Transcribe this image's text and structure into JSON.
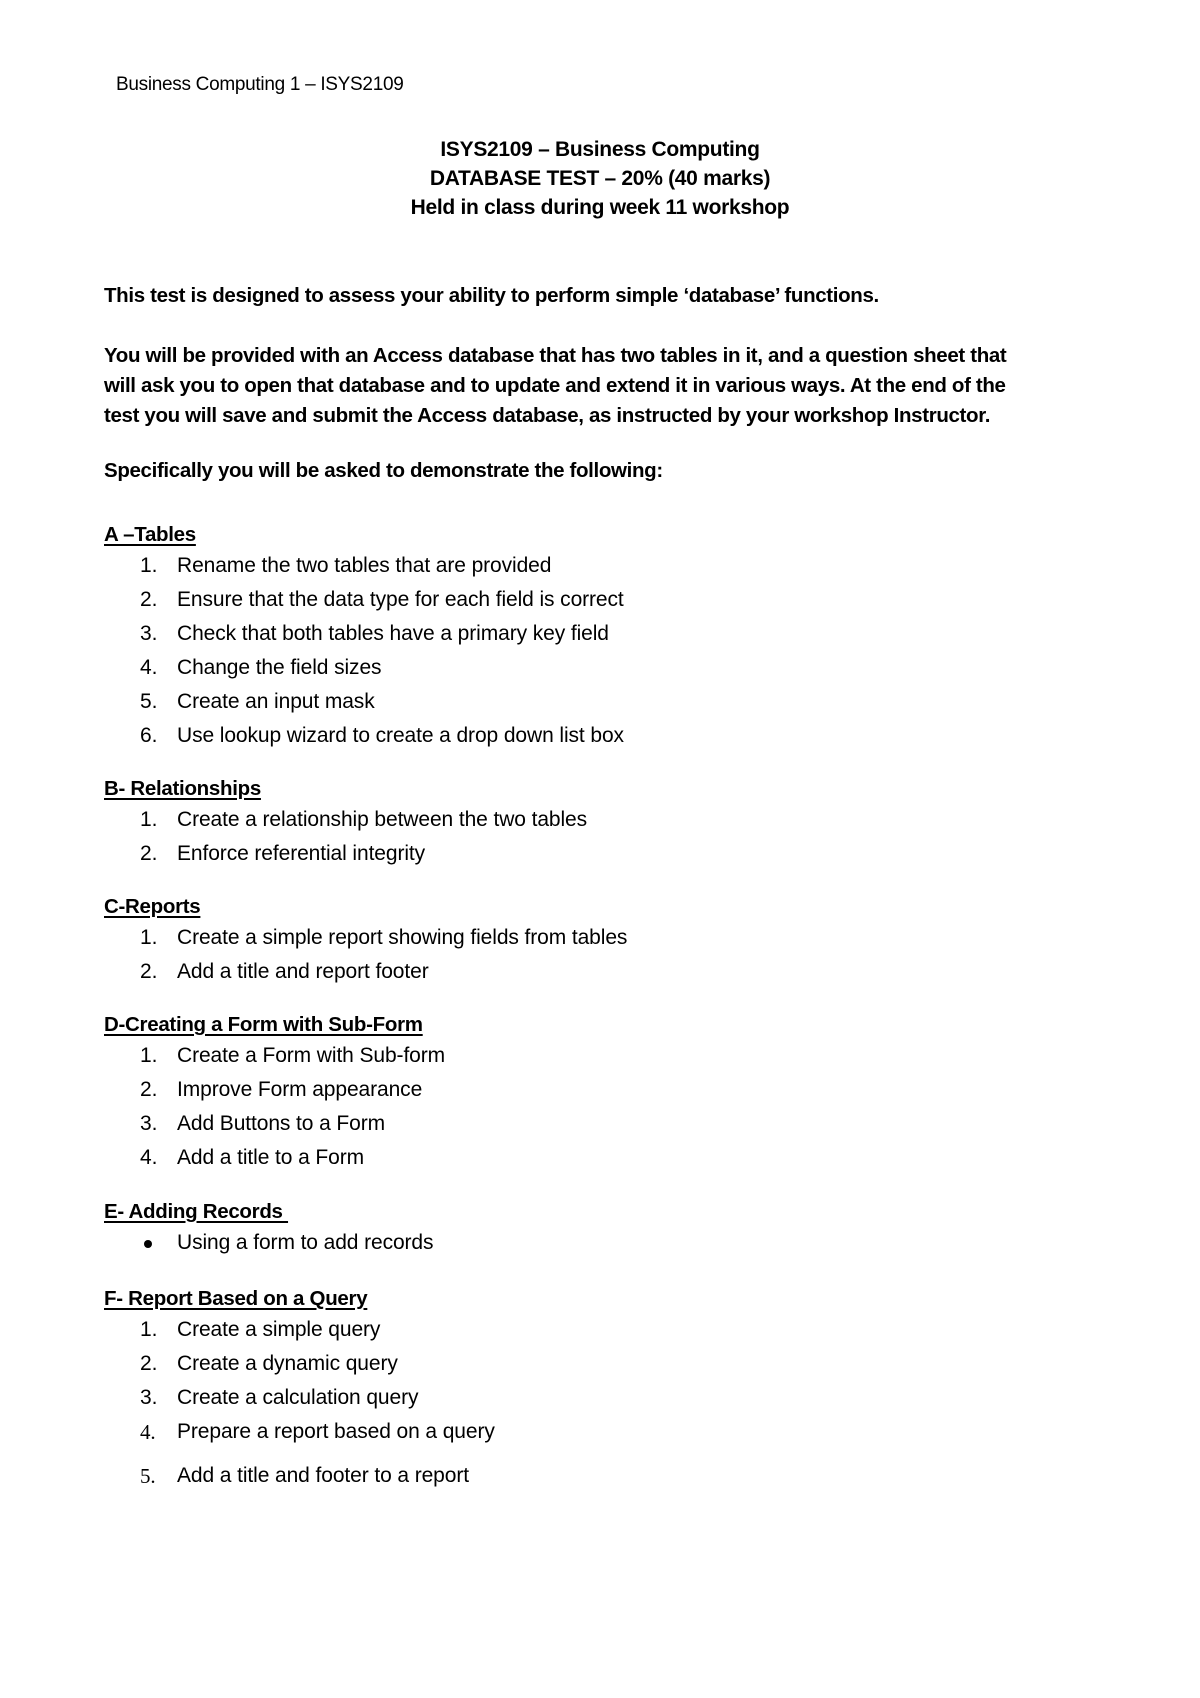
{
  "page_header": "Business Computing 1 – ISYS2109",
  "title_lines": [
    "ISYS2109 – Business Computing",
    "DATABASE TEST – 20% (40 marks)",
    "Held in class during week 11 workshop"
  ],
  "intro": "This test is designed to assess your ability to perform simple ‘database’ functions.",
  "description_lines": [
    "You will be provided with an Access database that has two tables in it, and a question sheet that",
    "will ask you to open that database and to update and extend it in various ways. At the end of the",
    "test you will save and submit the Access database, as instructed by your workshop Instructor."
  ],
  "lead_in": "Specifically you will be asked to demonstrate the following:",
  "sections": [
    {
      "heading": "A –Tables",
      "items": [
        {
          "marker": "1.",
          "text": "Rename the two tables that are provided"
        },
        {
          "marker": "2.",
          "text": "Ensure that the data type for each field is correct"
        },
        {
          "marker": "3.",
          "text": "Check that both tables have a primary key field"
        },
        {
          "marker": "4.",
          "text": "Change the field sizes"
        },
        {
          "marker": "5.",
          "text": "Create an input mask"
        },
        {
          "marker": "6.",
          "text": "Use lookup wizard to create a drop down list box"
        }
      ]
    },
    {
      "heading": "B- Relationships",
      "items": [
        {
          "marker": "1.",
          "text": "Create a relationship between the two tables"
        },
        {
          "marker": "2.",
          "text": "Enforce referential integrity"
        }
      ]
    },
    {
      "heading": "C-Reports",
      "items": [
        {
          "marker": "1.",
          "text": "Create a simple report showing fields from tables"
        },
        {
          "marker": "2.",
          "text": "Add a title and report footer"
        }
      ]
    },
    {
      "heading": "D-Creating a Form with Sub-Form",
      "items": [
        {
          "marker": "1.",
          "text": "Create a Form with Sub-form"
        },
        {
          "marker": "2.",
          "text": "Improve Form appearance"
        },
        {
          "marker": "3.",
          "text": "Add Buttons to a Form"
        },
        {
          "marker": "4.",
          "text": "Add a title to a Form"
        }
      ]
    },
    {
      "heading": "E- Adding Records ",
      "items": [
        {
          "marker": "bullet",
          "text": "Using a form to add records"
        }
      ]
    },
    {
      "heading": "F- Report Based on a Query",
      "items": [
        {
          "marker": "1.",
          "text": "Create a simple query"
        },
        {
          "marker": "2.",
          "text": "Create a dynamic query"
        },
        {
          "marker": "3.",
          "text": "Create a calculation query"
        },
        {
          "marker": "4.",
          "text": "Prepare a report based on a query"
        },
        {
          "marker": "5.",
          "text": "Add a title and footer to a report"
        }
      ]
    }
  ]
}
